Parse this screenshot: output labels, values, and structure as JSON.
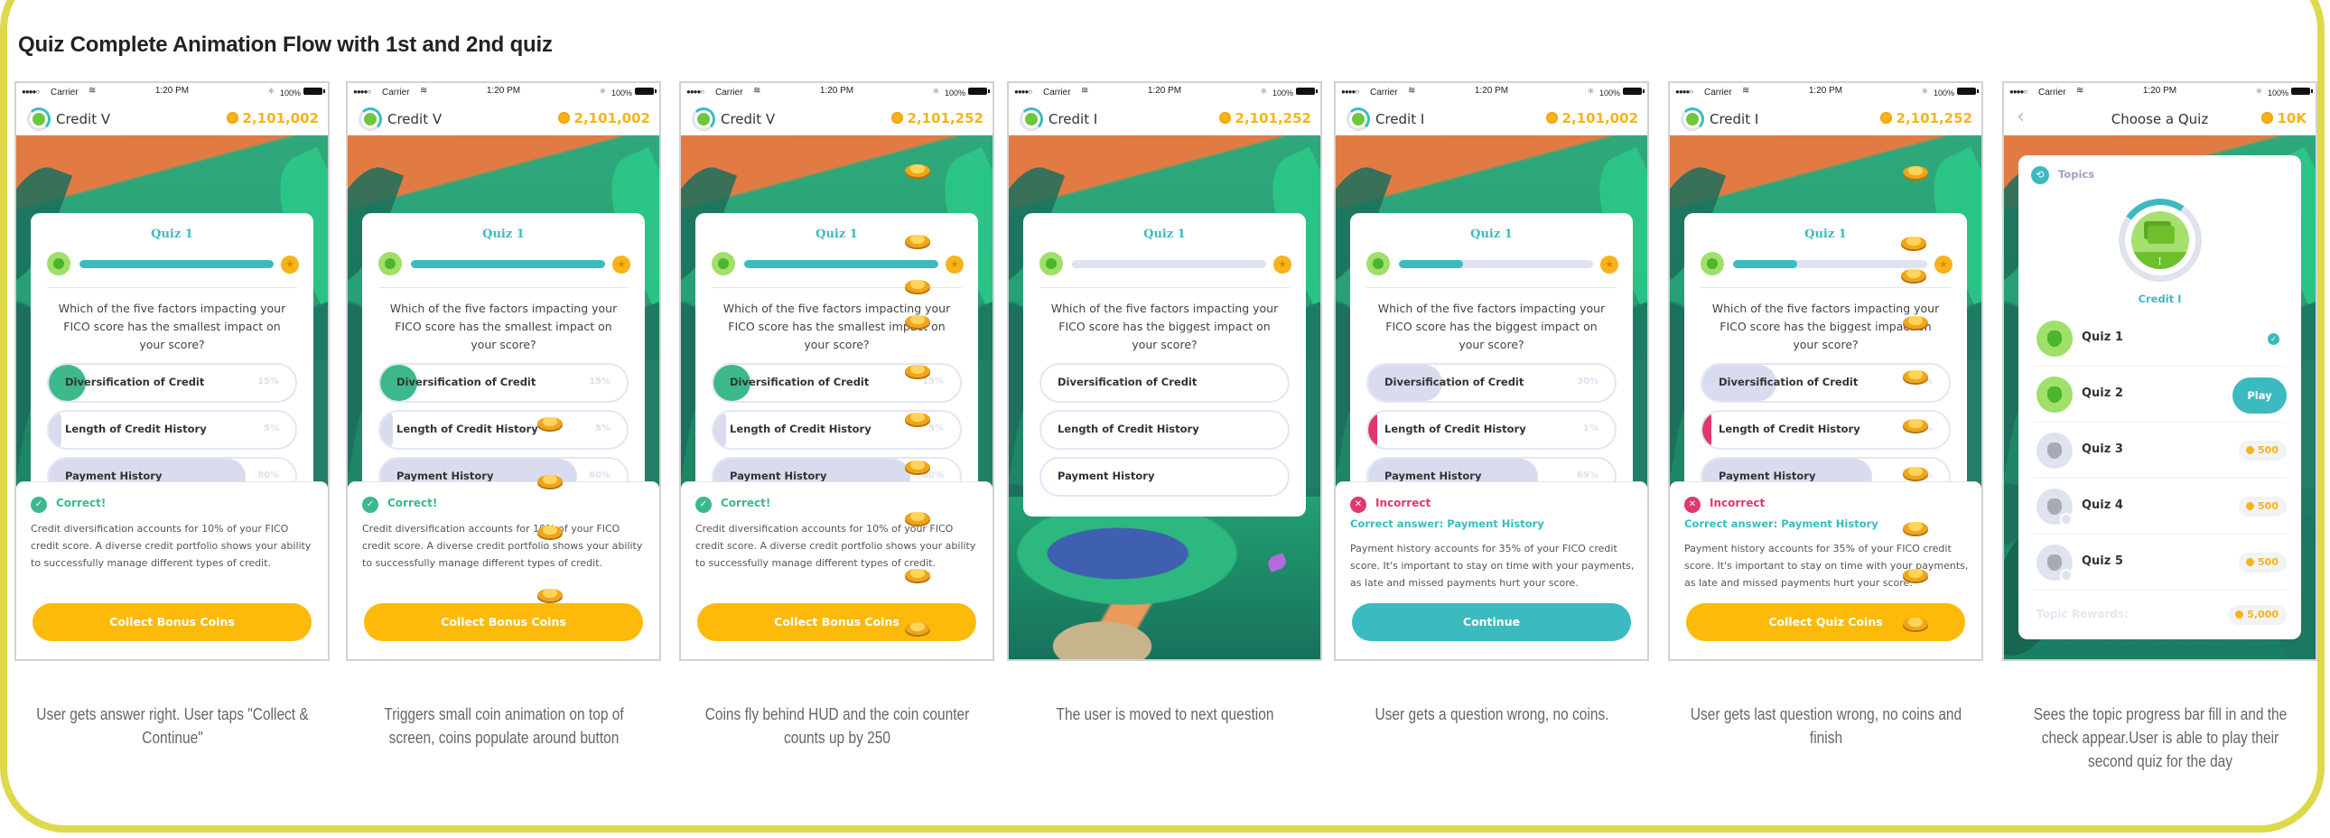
{
  "page_title": "Quiz Complete Animation Flow with 1st and 2nd quiz",
  "colors": {
    "frame": "#DED94A",
    "teal": "#3BBBBF",
    "correct_green": "#3DB88B",
    "incorrect_pink": "#E0386E",
    "coin_gold": "#F8B31A",
    "cta_yellow": "#FDBA0B",
    "fill_neutral": "#D8DCEE"
  },
  "status_bar": {
    "signal": "●●●●○",
    "carrier": "Carrier",
    "wifi_icon": "wifi-icon",
    "time": "1:20 PM",
    "bluetooth_icon": "bluetooth-icon",
    "battery": "100%"
  },
  "screens": [
    {
      "id": "screen-1",
      "caption": "User gets answer right. User taps \"Collect & Continue\"",
      "hud": {
        "topic": "Credit V",
        "coins": "2,101,002"
      },
      "quiz": {
        "title": "Quiz 1",
        "progress": 1.0,
        "question": "Which of the five factors impacting your FICO score has the smallest impact on your score?",
        "answers": [
          {
            "label": "Diversification of Credit",
            "pct": "15%",
            "fill": 0.15,
            "state": "correct"
          },
          {
            "label": "Length of Credit History",
            "pct": "5%",
            "fill": 0.05,
            "state": "neutral"
          },
          {
            "label": "Payment History",
            "pct": "80%",
            "fill": 0.8,
            "state": "neutral"
          }
        ]
      },
      "feedback": {
        "result": "correct",
        "status": "Correct!",
        "correct_answer": "",
        "explanation": "Credit diversification accounts for 10% of your FICO credit score. A diverse credit portfolio shows your ability to successfully manage different types of credit.",
        "cta": "Collect Bonus Coins",
        "cta_style": "yellow"
      },
      "coins_animation": []
    },
    {
      "id": "screen-2",
      "caption": "Triggers small coin animation on top of screen, coins populate around button",
      "hud": {
        "topic": "Credit V",
        "coins": "2,101,002"
      },
      "quiz": {
        "title": "Quiz 1",
        "progress": 1.0,
        "question": "Which of the five factors impacting your FICO score has the smallest impact on your score?",
        "answers": [
          {
            "label": "Diversification of Credit",
            "pct": "15%",
            "fill": 0.15,
            "state": "correct"
          },
          {
            "label": "Length of Credit History",
            "pct": "5%",
            "fill": 0.05,
            "state": "neutral"
          },
          {
            "label": "Payment History",
            "pct": "80%",
            "fill": 0.8,
            "state": "neutral"
          }
        ]
      },
      "feedback": {
        "result": "correct",
        "status": "Correct!",
        "correct_answer": "",
        "explanation": "Credit diversification accounts for 10% of your FICO credit score. A diverse credit portfolio shows your ability to successfully manage different types of credit.",
        "cta": "Collect Bonus Coins",
        "cta_style": "yellow"
      },
      "coins_animation": [
        "coin",
        "coin",
        "coin",
        "coin"
      ]
    },
    {
      "id": "screen-3",
      "caption": "Coins fly behind HUD and the coin counter counts up by 250",
      "hud": {
        "topic": "Credit V",
        "coins": "2,101,252"
      },
      "quiz": {
        "title": "Quiz 1",
        "progress": 1.0,
        "question": "Which of the five factors impacting your FICO score has the smallest impact on your score?",
        "answers": [
          {
            "label": "Diversification of Credit",
            "pct": "15%",
            "fill": 0.15,
            "state": "correct"
          },
          {
            "label": "Length of Credit History",
            "pct": "5%",
            "fill": 0.05,
            "state": "neutral"
          },
          {
            "label": "Payment History",
            "pct": "80%",
            "fill": 0.8,
            "state": "neutral"
          }
        ]
      },
      "feedback": {
        "result": "correct",
        "status": "Correct!",
        "correct_answer": "",
        "explanation": "Credit diversification accounts for 10% of your FICO credit score. A diverse credit portfolio shows your ability to successfully manage different types of credit.",
        "cta": "Collect Bonus Coins",
        "cta_style": "yellow"
      },
      "coins_animation": [
        "coin",
        "coin",
        "coin",
        "coin",
        "coin",
        "coin",
        "coin",
        "coin",
        "coin",
        "coin"
      ]
    },
    {
      "id": "screen-4",
      "caption": "The user is moved to next question",
      "hud": {
        "topic": "Credit I",
        "coins": "2,101,252"
      },
      "quiz": {
        "title": "Quiz 1",
        "progress": 0.0,
        "question": "Which of the five factors impacting your FICO score has the biggest impact on your score?",
        "answers": [
          {
            "label": "Diversification of Credit",
            "pct": "",
            "fill": 0,
            "state": "unanswered"
          },
          {
            "label": "Length of Credit History",
            "pct": "",
            "fill": 0,
            "state": "unanswered"
          },
          {
            "label": "Payment History",
            "pct": "",
            "fill": 0,
            "state": "unanswered"
          }
        ]
      },
      "feedback": null,
      "coins_animation": []
    },
    {
      "id": "screen-5",
      "caption": "User gets a question wrong, no coins.",
      "hud": {
        "topic": "Credit I",
        "coins": "2,101,002"
      },
      "quiz": {
        "title": "Quiz 1",
        "progress": 0.33,
        "question": "Which of the five factors impacting your FICO score has the biggest impact on your score?",
        "answers": [
          {
            "label": "Diversification of Credit",
            "pct": "30%",
            "fill": 0.3,
            "state": "neutral"
          },
          {
            "label": "Length of Credit History",
            "pct": "1%",
            "fill": 0.01,
            "state": "incorrect"
          },
          {
            "label": "Payment History",
            "pct": "69%",
            "fill": 0.69,
            "state": "neutral"
          }
        ]
      },
      "feedback": {
        "result": "incorrect",
        "status": "Incorrect",
        "correct_answer": "Correct answer: Payment History",
        "explanation": "Payment history accounts for 35% of your FICO credit score. It's important to stay on time with your payments, as late and missed payments hurt your score.",
        "cta": "Continue",
        "cta_style": "teal"
      },
      "coins_animation": []
    },
    {
      "id": "screen-6",
      "caption": "User gets last question wrong, no coins and finish",
      "hud": {
        "topic": "Credit I",
        "coins": "2,101,252"
      },
      "quiz": {
        "title": "Quiz 1",
        "progress": 0.33,
        "question": "Which of the five factors impacting your FICO score has the biggest impact on your score?",
        "answers": [
          {
            "label": "Diversification of Credit",
            "pct": "30%",
            "fill": 0.3,
            "state": "neutral"
          },
          {
            "label": "Length of Credit History",
            "pct": "1%",
            "fill": 0.01,
            "state": "incorrect"
          },
          {
            "label": "Payment History",
            "pct": "69%",
            "fill": 0.69,
            "state": "neutral"
          }
        ]
      },
      "feedback": {
        "result": "incorrect",
        "status": "Incorrect",
        "correct_answer": "Correct answer: Payment History",
        "explanation": "Payment history accounts for 35% of your FICO credit score. It's important to stay on time with your payments, as late and missed payments hurt your score.",
        "cta": "Collect Quiz Coins",
        "cta_style": "yellow"
      },
      "coins_animation": [
        "coin",
        "coin",
        "coin",
        "coin",
        "coin",
        "coin",
        "coin",
        "coin",
        "coin",
        "coin"
      ]
    }
  ],
  "chooser": {
    "caption": "Sees the topic progress bar fill in and the check appear.User is able to play their second quiz for the day",
    "hud": {
      "back_icon": "chevron-left-icon",
      "title": "Choose a Quiz",
      "coins": "10K"
    },
    "topics_label": "Topics",
    "topic_name": "Credit I",
    "topic_numeral": "I",
    "topic_progress": 0.2,
    "quizzes": [
      {
        "label": "Quiz 1",
        "state": "done"
      },
      {
        "label": "Quiz 2",
        "state": "play",
        "action": "Play"
      },
      {
        "label": "Quiz 3",
        "state": "locked",
        "reward": "500"
      },
      {
        "label": "Quiz 4",
        "state": "locked",
        "reward": "500"
      },
      {
        "label": "Quiz 5",
        "state": "locked",
        "reward": "500"
      }
    ],
    "topic_rewards_label": "Topic Rewards:",
    "topic_rewards_value": "5,000"
  }
}
